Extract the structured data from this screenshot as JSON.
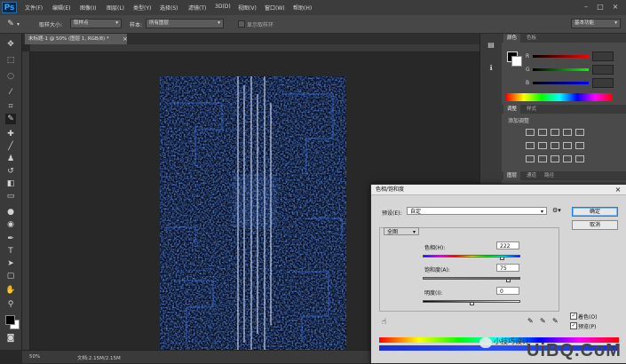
{
  "app": {
    "logo": "Ps"
  },
  "menu": [
    "文件(F)",
    "编辑(E)",
    "图像(I)",
    "图层(L)",
    "类型(Y)",
    "选择(S)",
    "滤镜(T)",
    "3D(D)",
    "视图(V)",
    "窗口(W)",
    "帮助(H)"
  ],
  "options_bar": {
    "size_label": "取样大小:",
    "size_value": "取样点",
    "sample_label": "样本:",
    "sample_value": "所有图层",
    "show_ring_label": "显示取样环",
    "workspace": "基本功能"
  },
  "document": {
    "tab_title": "未标题-1 @ 50% (图层 1, RGB/8) *",
    "zoom": "50%",
    "doc_info": "文档:2.15M/2.15M"
  },
  "color_panel": {
    "tabs": [
      "颜色",
      "色板"
    ],
    "channels": [
      "R",
      "G",
      "B"
    ]
  },
  "adjust_panel": {
    "tabs": [
      "调整",
      "样式"
    ],
    "subtitle": "添加调整"
  },
  "layers_panel": {
    "tabs": [
      "图层",
      "通道",
      "路径"
    ]
  },
  "dialog": {
    "title": "色相/饱和度",
    "preset_label": "预设(E):",
    "preset_value": "自定",
    "channel_value": "全图",
    "hue_label": "色相(H):",
    "hue_value": "222",
    "hue_level": 0.81,
    "sat_label": "饱和度(A):",
    "sat_value": "75",
    "sat_level": 0.875,
    "light_label": "明度(I):",
    "light_value": "0",
    "light_level": 0.5,
    "ok_label": "确定",
    "cancel_label": "取消",
    "colorize_label": "着色(O)",
    "colorize_checked": true,
    "preview_label": "预览(P)",
    "preview_checked": true
  },
  "watermark": {
    "text": "UiBQ.CoM",
    "caption": "小技巧设计"
  },
  "colors": {
    "accent_blue": "#1d7ee0",
    "dialog_bg": "#d6d6d6"
  },
  "icons": [
    "eyedropper-icon",
    "move-icon",
    "marquee-icon",
    "lasso-icon",
    "magic-wand-icon",
    "crop-icon",
    "eyedropper-tool-icon",
    "healing-icon",
    "brush-icon",
    "stamp-icon",
    "history-brush-icon",
    "eraser-icon",
    "gradient-icon",
    "blur-icon",
    "dodge-icon",
    "pen-icon",
    "type-icon",
    "path-select-icon",
    "shape-icon",
    "hand-icon",
    "zoom-icon",
    "swatch-icon",
    "quickmask-icon",
    "screenmode-icon",
    "hand-cursor-icon"
  ]
}
